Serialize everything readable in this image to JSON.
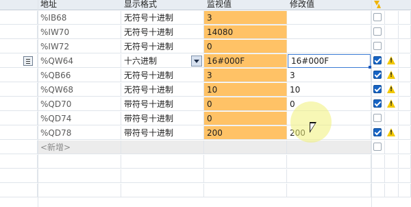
{
  "header": {
    "address": "地址",
    "display_format": "显示格式",
    "monitor_value": "监视值",
    "modify_value": "修改值"
  },
  "rows": [
    {
      "address": "%IB68",
      "format": "无符号十进制",
      "monitor": "3",
      "modify": "",
      "modify_checked": false,
      "warning": false
    },
    {
      "address": "%IW70",
      "format": "无符号十进制",
      "monitor": "14080",
      "modify": "",
      "modify_checked": false,
      "warning": false
    },
    {
      "address": "%IW72",
      "format": "无符号十进制",
      "monitor": "0",
      "modify": "",
      "modify_checked": false,
      "warning": false
    },
    {
      "address": "%QW64",
      "format": "十六进制",
      "monitor": "16#000F",
      "modify": "16#000F",
      "modify_checked": true,
      "warning": true,
      "selected": true
    },
    {
      "address": "%QB66",
      "format": "无符号十进制",
      "monitor": "3",
      "modify": "3",
      "modify_checked": true,
      "warning": true
    },
    {
      "address": "%QW68",
      "format": "无符号十进制",
      "monitor": "10",
      "modify": "10",
      "modify_checked": true,
      "warning": true
    },
    {
      "address": "%QD70",
      "format": "带符号十进制",
      "monitor": "0",
      "modify": "0",
      "modify_checked": true,
      "warning": true
    },
    {
      "address": "%QD74",
      "format": "带符号十进制",
      "monitor": "0",
      "modify": "",
      "modify_checked": false,
      "warning": false
    },
    {
      "address": "%QD78",
      "format": "带符号十进制",
      "monitor": "200",
      "modify": "200",
      "modify_checked": true,
      "warning": true
    }
  ],
  "new_row": {
    "address": "<新增>"
  },
  "colors": {
    "monitor_bg": "#ffc266",
    "checkbox_on": "#1764c4",
    "warning": "#f2c800",
    "header_bg": "#e8edf3"
  },
  "icons": {
    "header_extra": "lightning-icon",
    "row_marker": "row-list-icon",
    "dropdown": "chevron-down-icon",
    "warning": "warning-icon"
  }
}
